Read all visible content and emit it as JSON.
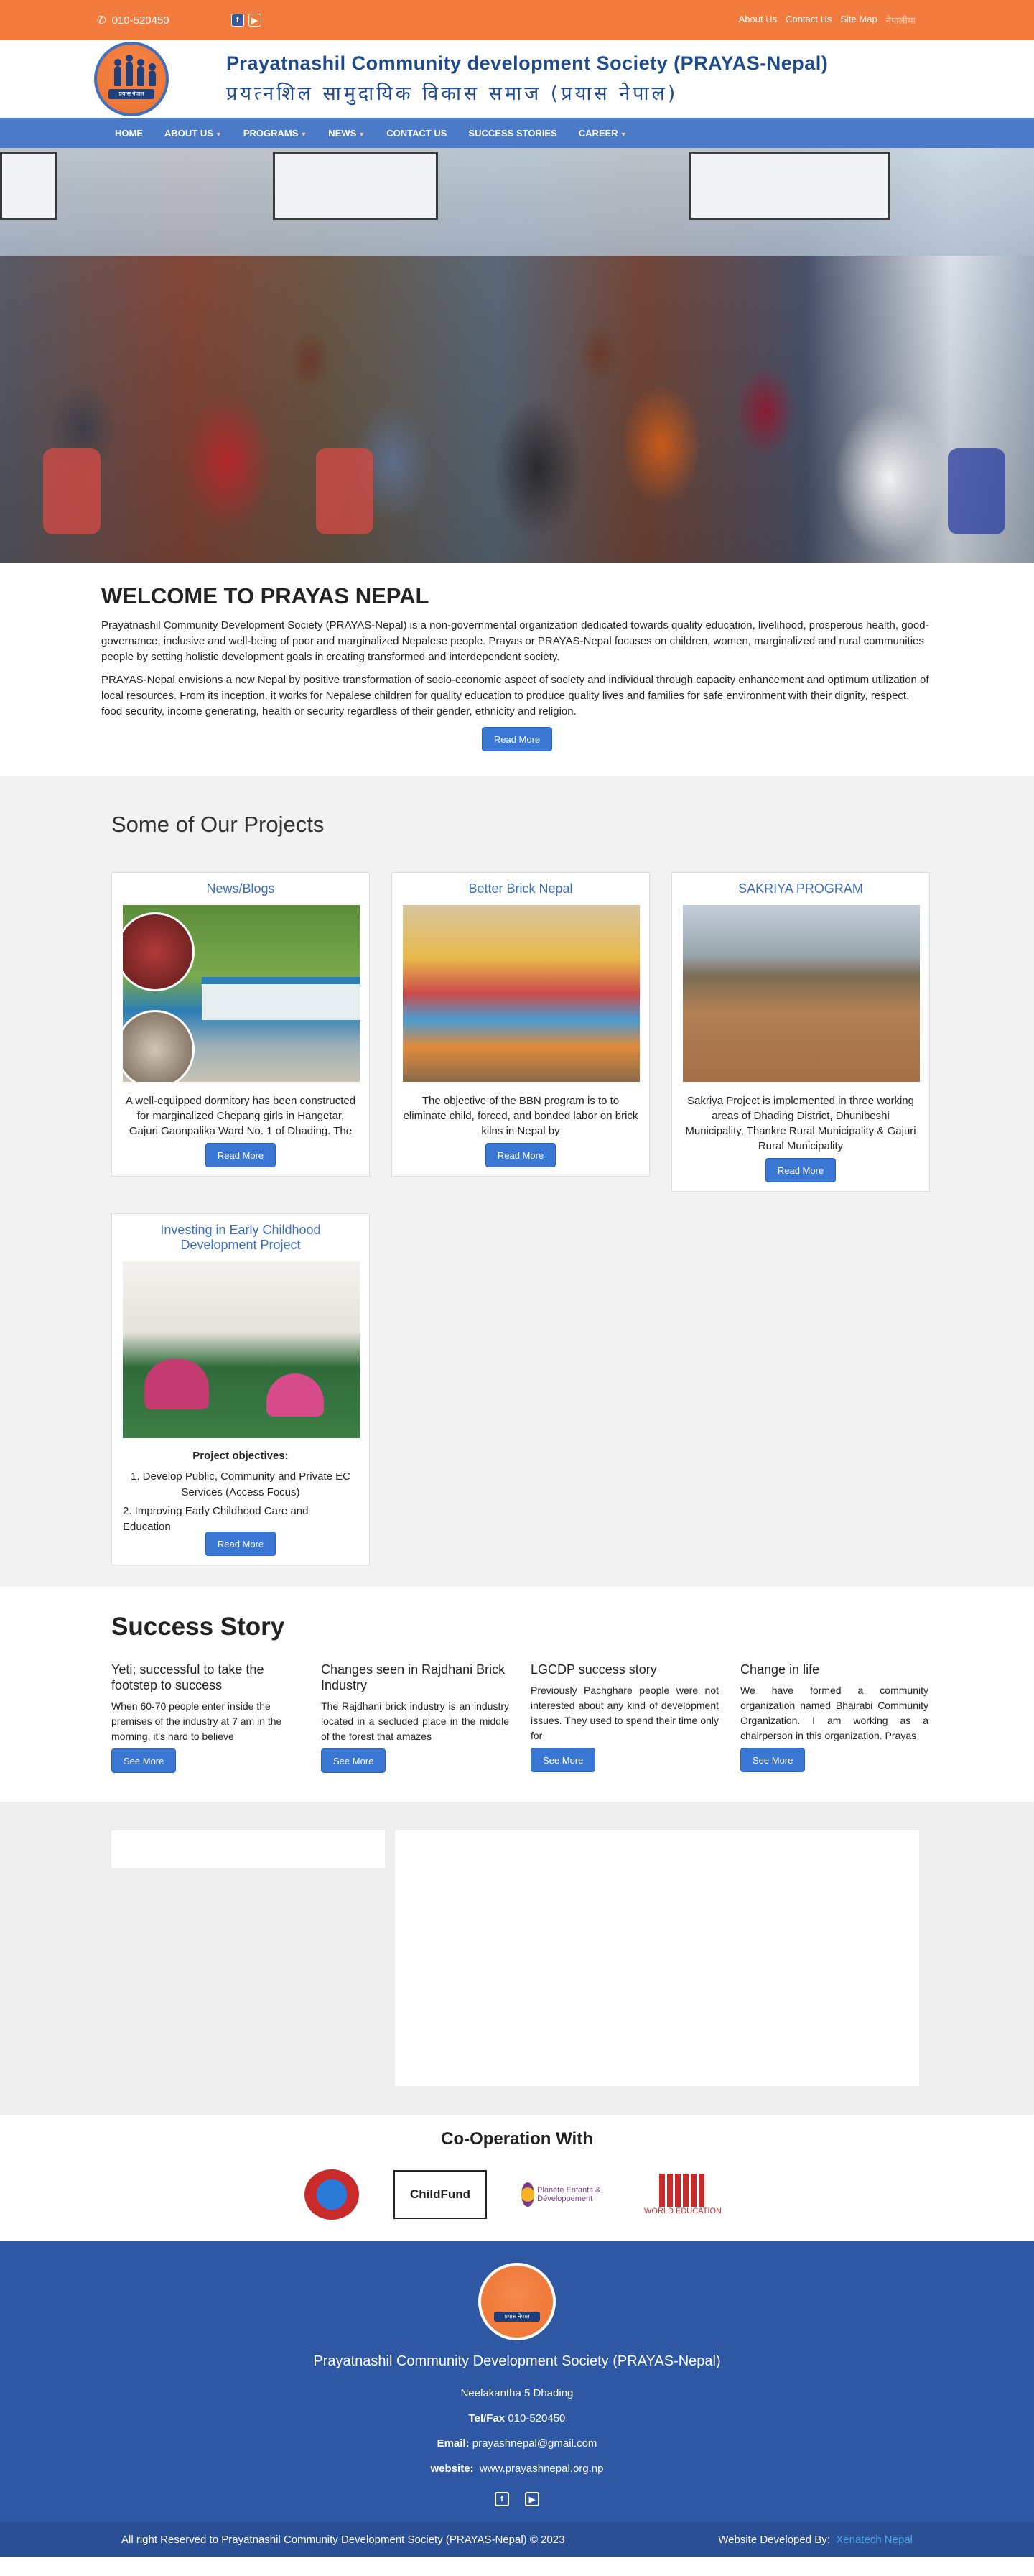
{
  "topbar": {
    "phone": "010-520450",
    "links": [
      "About Us",
      "Contact Us",
      "Site Map",
      "नेपालीमा"
    ]
  },
  "header": {
    "org_en": "Prayatnashil Community development Society (PRAYAS-Nepal)",
    "org_ne": "प्रयत्नशिल सामुदायिक विकास समाज (प्रयास नेपाल)",
    "logo_text": "प्रयास नेपाल"
  },
  "nav": {
    "items": [
      {
        "label": "HOME",
        "dropdown": false
      },
      {
        "label": "ABOUT US",
        "dropdown": true
      },
      {
        "label": "PROGRAMS",
        "dropdown": true
      },
      {
        "label": "NEWS",
        "dropdown": true
      },
      {
        "label": "CONTACT US",
        "dropdown": false
      },
      {
        "label": "SUCCESS STORIES",
        "dropdown": false
      },
      {
        "label": "CAREER",
        "dropdown": true
      }
    ]
  },
  "welcome": {
    "title": "WELCOME TO PRAYAS NEPAL",
    "para1": "Prayatnashil Community Development Society (PRAYAS-Nepal) is a non-governmental organization dedicated towards quality education, livelihood, prosperous health, good- governance, inclusive and well-being of poor and marginalized Nepalese people. Prayas or PRAYAS-Nepal focuses on children, women, marginalized and rural communities people by setting holistic development goals in creating transformed and interdependent society.",
    "para2": "PRAYAS-Nepal envisions a new Nepal by positive transformation of socio-economic aspect of society and individual through capacity enhancement and optimum utilization of local resources. From its inception, it works for Nepalese children for quality education to produce quality lives and families for safe environment with their dignity, respect, food security, income generating, health or security regardless of their gender, ethnicity and religion.",
    "button": "Read More"
  },
  "projects": {
    "title": "Some of Our Projects",
    "cards": [
      {
        "title": "News/Blogs",
        "text": "A well-equipped dormitory has been constructed for marginalized Chepang girls in Hangetar, Gajuri Gaonpalika Ward No. 1 of Dhading. The",
        "button": "Read More"
      },
      {
        "title": "Better Brick Nepal",
        "text": "The objective of the BBN program is to to eliminate child, forced, and bonded labor on brick kilns in Nepal by",
        "button": "Read More"
      },
      {
        "title": "SAKRIYA PROGRAM",
        "text": "Sakriya Project is implemented in three working areas of Dhading District, Dhunibeshi Municipality, Thankre Rural Municipality & Gajuri Rural Municipality",
        "button": "Read More"
      },
      {
        "title": "Investing in Early Childhood Development Project",
        "objectives_label": "Project objectives:",
        "objectives": [
          "1.    Develop Public, Community and Private EC Services (Access Focus)",
          "2. Improving Early Childhood Care and Education"
        ],
        "button": "Read More"
      }
    ]
  },
  "success": {
    "title": "Success Story",
    "stories": [
      {
        "title": "Yeti; successful to take the footstep to success",
        "text": "When 60-70 people enter inside the premises of the industry at 7 am in the morning, it's hard to believe",
        "button": "See More"
      },
      {
        "title": "Changes seen in Rajdhani Brick Industry",
        "text": "The Rajdhani brick industry is an industry located in a secluded place in the middle of the forest that amazes",
        "button": "See More"
      },
      {
        "title": "LGCDP success story",
        "text": "Previously Pachghare people were not interested about any kind of development issues. They used to spend their time only for",
        "button": "See More"
      },
      {
        "title": "Change in life",
        "text": "We have formed a community organization named Bhairabi Community Organization. I am working as a chairperson in this organization. Prayas",
        "button": "See More"
      }
    ]
  },
  "coop": {
    "title": "Co-Operation With",
    "partners": [
      "ChildFund",
      "Planète Enfants & Développement",
      "WORLD EDUCATION"
    ]
  },
  "footer": {
    "name": "Prayatnashil Community Development Society (PRAYAS-Nepal)",
    "address": "Neelakantha 5 Dhading",
    "tel_label": "Tel/Fax",
    "tel": "010-520450",
    "email_label": "Email:",
    "email": "prayashnepal@gmail.com",
    "website_label": "website:",
    "website": "www.prayashnepal.org.np",
    "copyright": "All right Reserved to Prayatnashil Community Development Society (PRAYAS-Nepal) © 2023",
    "dev_label": "Website Developed By:",
    "dev_name": "Xenatech Nepal"
  }
}
